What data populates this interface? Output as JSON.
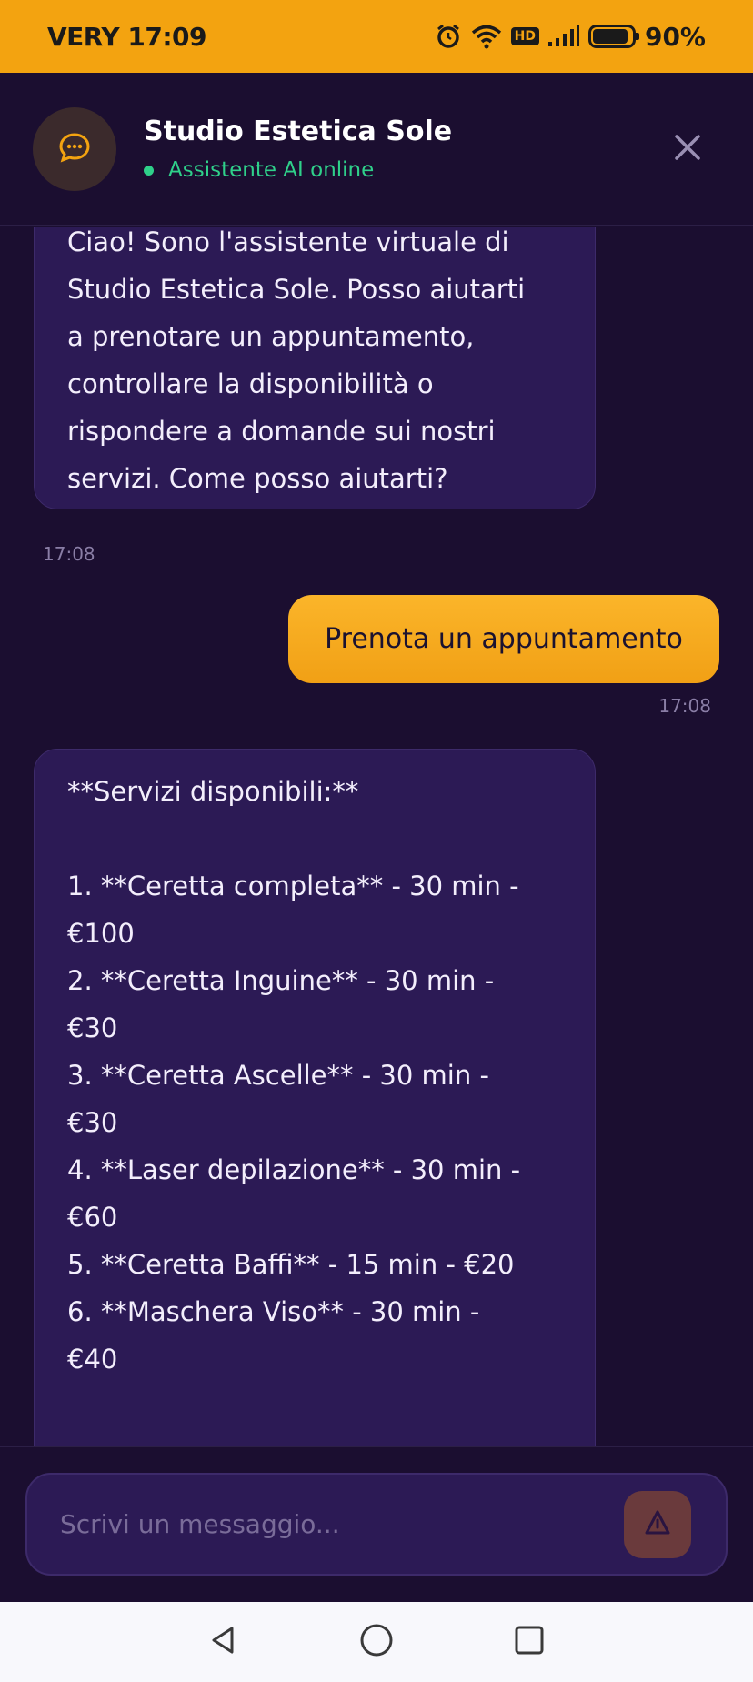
{
  "status_bar": {
    "carrier_time": "VERY 17:09",
    "hd_label": "HD",
    "battery": "90%",
    "battery_level": 0.9
  },
  "header": {
    "title": "Studio Estetica Sole",
    "status": "Assistente AI online",
    "avatar_icon": "chat-bubble-icon",
    "close_icon": "close-icon"
  },
  "messages": [
    {
      "sender": "bot",
      "text": "Ciao! Sono l'assistente virtuale di\nStudio Estetica Sole. Posso aiutarti\na prenotare un appuntamento,\ncontrollare la disponibilità o\nrispondere a domande sui nostri\nservizi. Come posso aiutarti?",
      "time": "17:08"
    },
    {
      "sender": "user",
      "text": "Prenota un appuntamento",
      "time": "17:08"
    },
    {
      "sender": "bot",
      "text": "**Servizi disponibili:**\n\n1. **Ceretta completa** - 30 min -\n€100\n2. **Ceretta Inguine** - 30 min -\n€30\n3. **Ceretta Ascelle** - 30 min -\n€30\n4. **Laser depilazione** - 30 min -\n€60\n5. **Ceretta Baffi** - 15 min - €20\n6. **Maschera Viso** - 30 min -\n€40"
    }
  ],
  "composer": {
    "placeholder": "Scrivi un messaggio...",
    "send_icon": "send-icon"
  },
  "colors": {
    "accent": "#f3a310",
    "background": "#1b0e30",
    "bot_bubble": "#2c1a55",
    "online": "#2fd08a"
  }
}
